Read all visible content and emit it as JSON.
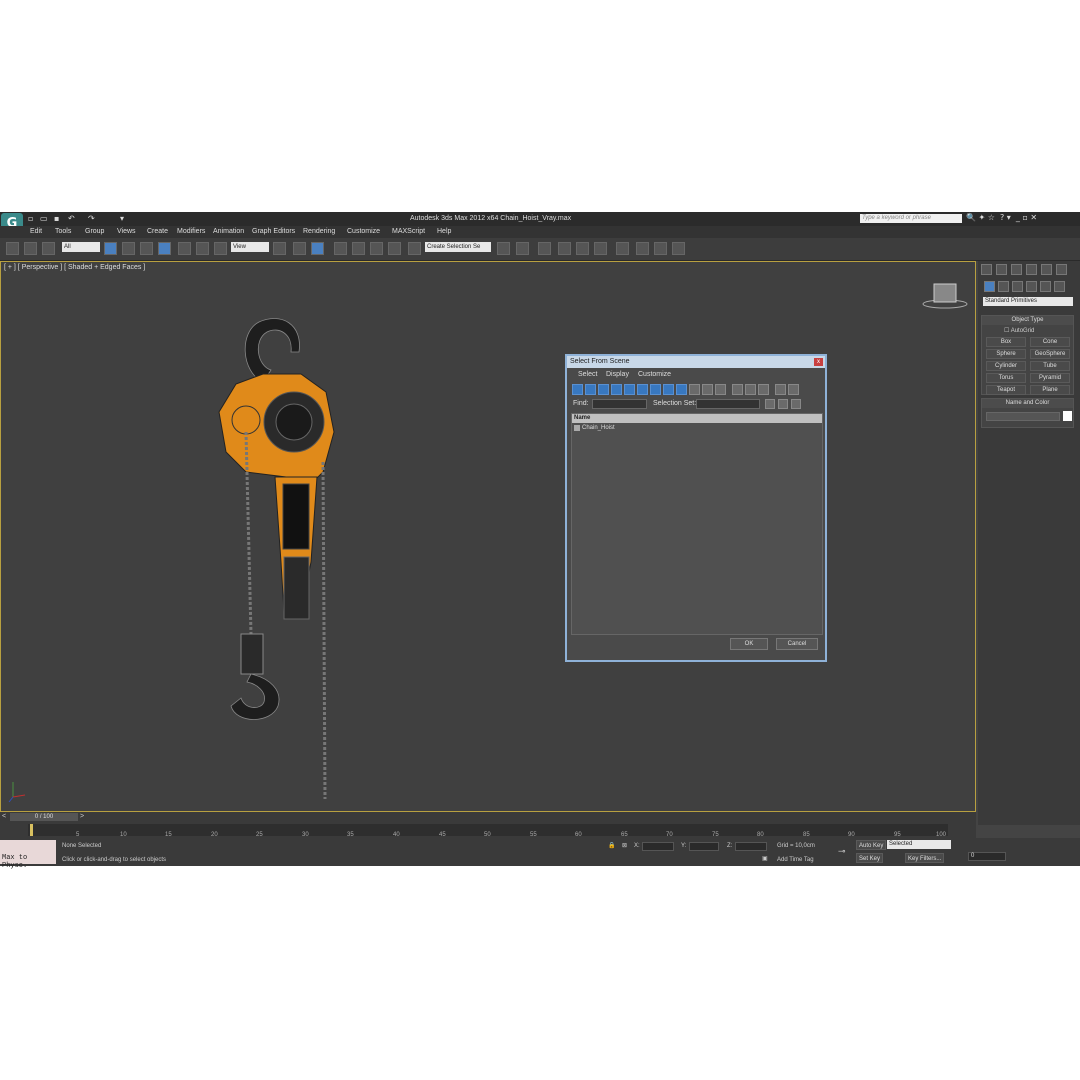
{
  "app": {
    "title": "Autodesk 3ds Max  2012 x64     Chain_Hoist_Vray.max",
    "search_placeholder": "Type a keyword or phrase",
    "logo": "G"
  },
  "menu": [
    "Edit",
    "Tools",
    "Group",
    "Views",
    "Create",
    "Modifiers",
    "Animation",
    "Graph Editors",
    "Rendering",
    "Customize",
    "MAXScript",
    "Help"
  ],
  "toolbar": {
    "filter_value": "All",
    "refcoord_value": "View",
    "named_selection": "Create Selection Se"
  },
  "viewport": {
    "label": "[ + ] [ Perspective ] [ Shaded + Edged Faces ]"
  },
  "command_panel": {
    "category_dropdown": "Standard Primitives",
    "object_type_title": "Object Type",
    "autogrid_label": "AutoGrid",
    "objects": [
      "Box",
      "Cone",
      "Sphere",
      "GeoSphere",
      "Cylinder",
      "Tube",
      "Torus",
      "Pyramid",
      "Teapot",
      "Plane"
    ],
    "name_color_title": "Name and Color"
  },
  "timeline": {
    "slider_label": "0 / 100",
    "ticks": [
      "5",
      "10",
      "15",
      "20",
      "25",
      "30",
      "35",
      "40",
      "45",
      "50",
      "55",
      "60",
      "65",
      "70",
      "75",
      "80",
      "85",
      "90",
      "95",
      "100"
    ]
  },
  "status": {
    "maxscript": "Max to Physc.",
    "selection": "None Selected",
    "prompt": "Click or click-and-drag to select objects",
    "x_label": "X:",
    "y_label": "Y:",
    "z_label": "Z:",
    "grid": "Grid = 10,0cm",
    "add_time_tag": "Add Time Tag",
    "auto_key": "Auto Key",
    "set_key": "Set Key",
    "key_mode": "Selected",
    "key_filters": "Key Filters...",
    "frame": "0"
  },
  "dialog": {
    "title": "Select From Scene",
    "close": "x",
    "menus": [
      "Select",
      "Display",
      "Customize"
    ],
    "find_label": "Find:",
    "selection_set_label": "Selection Set:",
    "column_name": "Name",
    "items": [
      "Chain_Hoist"
    ],
    "ok": "OK",
    "cancel": "Cancel"
  },
  "colors": {
    "hoist_orange": "#e08a1a",
    "viewport_bg": "#404040",
    "dialog_border": "#8fb2d8",
    "active_tool": "#4a80c0"
  }
}
